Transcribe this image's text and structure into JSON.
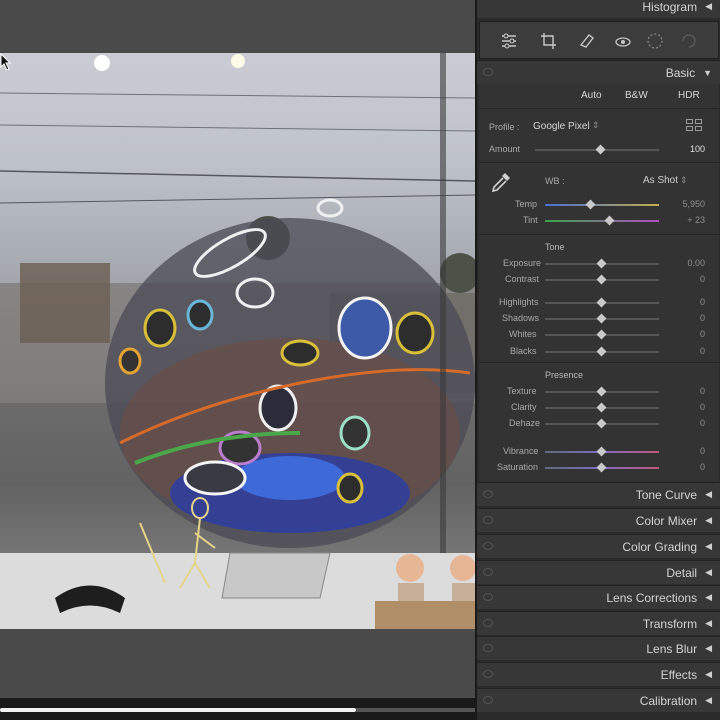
{
  "panel": {
    "histogram_label": "Histogram",
    "basic_label": "Basic",
    "tools": [
      "edit-sliders-icon",
      "crop-icon",
      "healing-icon",
      "redeye-icon",
      "masking-icon",
      "presets-icon"
    ],
    "treatment": {
      "auto": "Auto",
      "bw": "B&W",
      "hdr": "HDR"
    },
    "profile": {
      "label": "Profile :",
      "value": "Google Pixel",
      "amount_label": "Amount",
      "amount_value": "100"
    },
    "wb": {
      "label": "WB :",
      "value": "As Shot"
    },
    "temp": {
      "label": "Temp",
      "value": "5,950"
    },
    "tint": {
      "label": "Tint",
      "value": "+ 23"
    },
    "tone_label": "Tone",
    "exposure": {
      "label": "Exposure",
      "value": "0.00"
    },
    "contrast": {
      "label": "Contrast",
      "value": "0"
    },
    "highlights": {
      "label": "Highlights",
      "value": "0"
    },
    "shadows": {
      "label": "Shadows",
      "value": "0"
    },
    "whites": {
      "label": "Whites",
      "value": "0"
    },
    "blacks": {
      "label": "Blacks",
      "value": "0"
    },
    "presence_label": "Presence",
    "texture": {
      "label": "Texture",
      "value": "0"
    },
    "clarity": {
      "label": "Clarity",
      "value": "0"
    },
    "dehaze": {
      "label": "Dehaze",
      "value": "0"
    },
    "vibrance": {
      "label": "Vibrance",
      "value": "0"
    },
    "saturation": {
      "label": "Saturation",
      "value": "0"
    },
    "sections": [
      "Tone Curve",
      "Color Mixer",
      "Color Grading",
      "Detail",
      "Lens Corrections",
      "Transform",
      "Lens Blur",
      "Effects",
      "Calibration"
    ]
  },
  "scrubber": {
    "progress": 0.75
  },
  "colors": {
    "panel_bg": "#2b2b2b",
    "header_bg": "#373737",
    "accent_temp": "#4b6fd6",
    "accent_tint": "#3aa34a"
  }
}
